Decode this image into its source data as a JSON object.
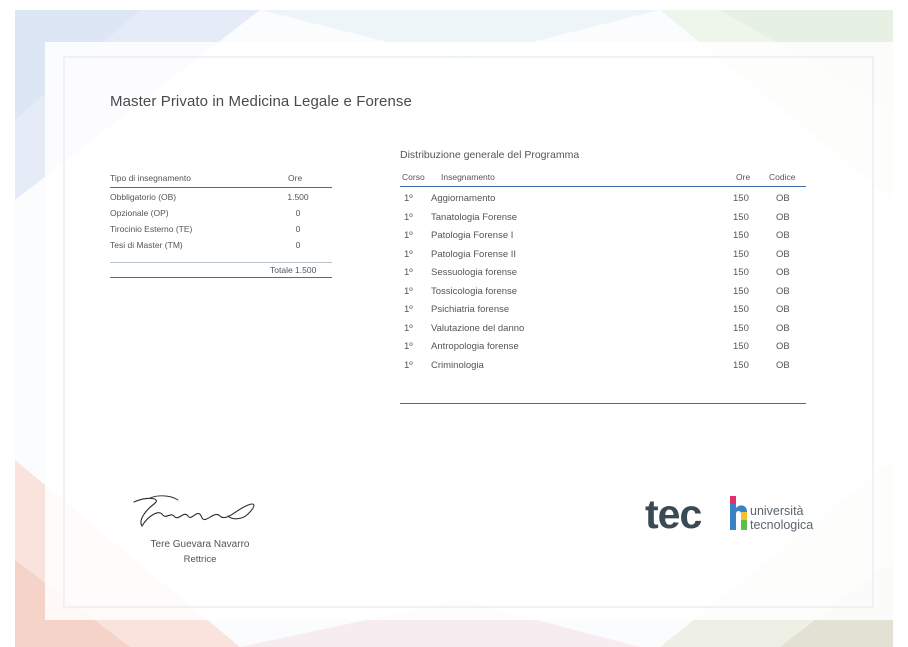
{
  "document": {
    "title": "Master Privato in Medicina Legale e Forense"
  },
  "hours_table": {
    "headers": {
      "type": "Tipo di insegnamento",
      "hours": "Ore"
    },
    "rows": [
      {
        "type": "Obbligatorio (OB)",
        "hours": "1.500"
      },
      {
        "type": "Opzionale (OP)",
        "hours": "0"
      },
      {
        "type": "Tirocinio Esterno (TE)",
        "hours": "0"
      },
      {
        "type": "Tesi di Master (TM)",
        "hours": "0"
      }
    ],
    "total": "Totale 1.500"
  },
  "program": {
    "title": "Distribuzione generale del Programma",
    "headers": {
      "course": "Corso",
      "subject": "Insegnamento",
      "hours": "Ore",
      "code": "Codice"
    },
    "rows": [
      {
        "course": "1º",
        "subject": "Aggiornamento",
        "hours": "150",
        "code": "OB"
      },
      {
        "course": "1º",
        "subject": "Tanatologia Forense",
        "hours": "150",
        "code": "OB"
      },
      {
        "course": "1º",
        "subject": "Patologia Forense I",
        "hours": "150",
        "code": "OB"
      },
      {
        "course": "1º",
        "subject": "Patologia Forense II",
        "hours": "150",
        "code": "OB"
      },
      {
        "course": "1º",
        "subject": "Sessuologia forense",
        "hours": "150",
        "code": "OB"
      },
      {
        "course": "1º",
        "subject": "Tossicologia forense",
        "hours": "150",
        "code": "OB"
      },
      {
        "course": "1º",
        "subject": "Psichiatria forense",
        "hours": "150",
        "code": "OB"
      },
      {
        "course": "1º",
        "subject": "Valutazione del danno",
        "hours": "150",
        "code": "OB"
      },
      {
        "course": "1º",
        "subject": "Antropologia forense",
        "hours": "150",
        "code": "OB"
      },
      {
        "course": "1º",
        "subject": "Criminologia",
        "hours": "150",
        "code": "OB"
      }
    ]
  },
  "signatory": {
    "name": "Tere Guevara Navarro",
    "role": "Rettrice"
  },
  "logo": {
    "wordmark": "tech",
    "line1": "università",
    "line2": "tecnologica"
  },
  "colors": {
    "accent_blue": "#3e6fa8",
    "logo_dark": "#3a4a55"
  }
}
